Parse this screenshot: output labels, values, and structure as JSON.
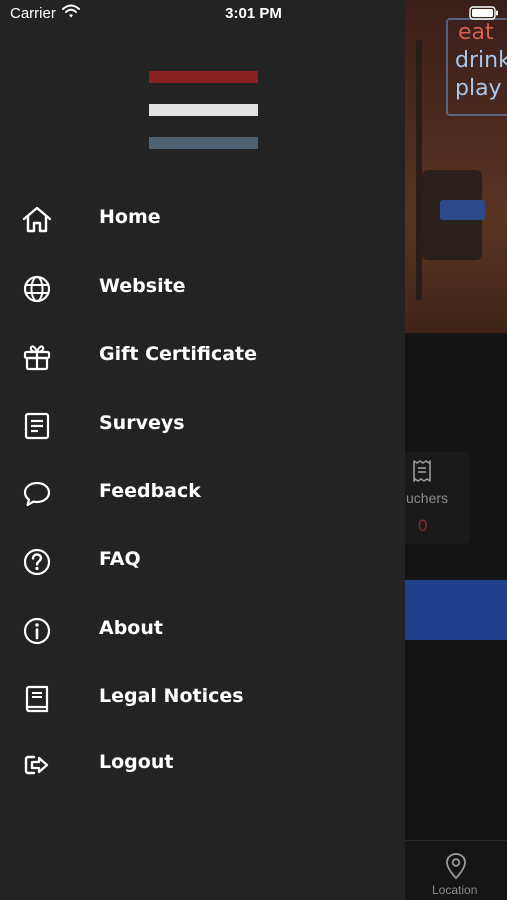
{
  "status_bar": {
    "carrier": "Carrier",
    "time": "3:01 PM",
    "wifi_icon": "wifi-icon",
    "battery_icon": "battery-icon"
  },
  "background": {
    "neon_words": [
      "eat",
      "drink",
      "play"
    ],
    "vouchers_label": "Vouchers",
    "vouchers_visible_label": "uchers",
    "vouchers_count": "0",
    "tabbar_location_label": "Location",
    "accent_blue": "#1f3f8a",
    "accent_red": "#8a2a2a"
  },
  "drawer": {
    "background_color": "#232323",
    "logo_colors": [
      "#8a2223",
      "#e2e2e2",
      "#4d6172"
    ],
    "items": [
      {
        "label": "Home",
        "icon": "home-icon"
      },
      {
        "label": "Website",
        "icon": "globe-icon"
      },
      {
        "label": "Gift Certificate",
        "icon": "gift-icon"
      },
      {
        "label": "Surveys",
        "icon": "survey-icon"
      },
      {
        "label": "Feedback",
        "icon": "chat-bubble-icon"
      },
      {
        "label": "FAQ",
        "icon": "question-icon"
      },
      {
        "label": "About",
        "icon": "info-icon"
      },
      {
        "label": "Legal Notices",
        "icon": "book-icon"
      },
      {
        "label": "Logout",
        "icon": "logout-icon"
      }
    ]
  }
}
